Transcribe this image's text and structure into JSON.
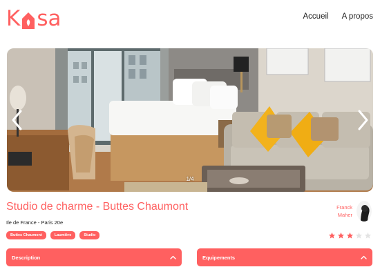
{
  "header": {
    "logo_text_left": "K",
    "logo_text_right": "sa",
    "nav": [
      {
        "label": "Accueil"
      },
      {
        "label": "A propos"
      }
    ]
  },
  "carousel": {
    "counter": "1/4"
  },
  "listing": {
    "title": "Studio de charme - Buttes Chaumont",
    "location": "Ile de France - Paris 20e",
    "tags": [
      "Buttes Chaumont",
      "Laumière",
      "Studio"
    ],
    "host": {
      "first_name": "Franck",
      "last_name": "Maher"
    },
    "rating": 3,
    "rating_max": 5
  },
  "collapses": [
    {
      "label": "Description"
    },
    {
      "label": "Equipements"
    }
  ],
  "colors": {
    "accent": "#ff6060",
    "star_off": "#e3e3e3"
  }
}
